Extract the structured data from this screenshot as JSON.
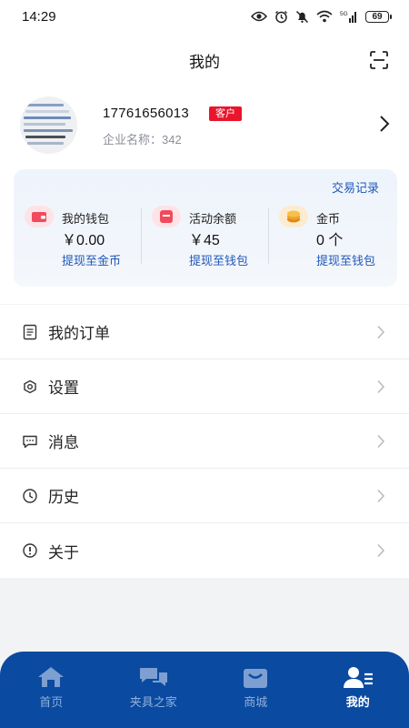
{
  "status_bar": {
    "time": "14:29",
    "battery": "69"
  },
  "header": {
    "title": "我的"
  },
  "profile": {
    "phone": "17761656013",
    "badge": "客户",
    "company": "企业名称：342"
  },
  "wallet": {
    "tx_link": "交易记录",
    "items": [
      {
        "label": "我的钱包",
        "value": "￥0.00",
        "link": "提现至金币",
        "icon": "wallet-icon",
        "color": "#ef4b5d"
      },
      {
        "label": "活动余额",
        "value": "￥45",
        "link": "提现至钱包",
        "icon": "gift-box-icon",
        "color": "#ef4b5d"
      },
      {
        "label": "金币",
        "value": "0 个",
        "link": "提现至钱包",
        "icon": "coin-stack-icon",
        "color": "#f0a12b"
      }
    ]
  },
  "menu": {
    "items": [
      {
        "label": "我的订单",
        "icon": "order-list-icon"
      },
      {
        "label": "设置",
        "icon": "settings-icon"
      },
      {
        "label": "消息",
        "icon": "message-icon"
      },
      {
        "label": "历史",
        "icon": "clock-icon"
      },
      {
        "label": "关于",
        "icon": "info-icon"
      }
    ]
  },
  "tabbar": {
    "items": [
      {
        "label": "首页",
        "icon": "home-icon"
      },
      {
        "label": "夹具之家",
        "icon": "chat-bubbles-icon"
      },
      {
        "label": "商城",
        "icon": "shopping-bag-icon"
      },
      {
        "label": "我的",
        "icon": "user-list-icon",
        "active": true
      }
    ]
  },
  "colors": {
    "primary": "#0a4aa0",
    "link": "#1f57b8",
    "badge": "#e8152b"
  }
}
